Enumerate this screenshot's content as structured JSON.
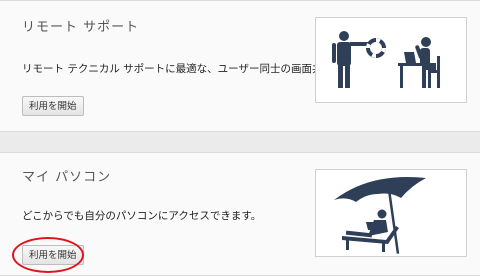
{
  "remote_support": {
    "title": "リモート サポート",
    "description": "リモート テクニカル サポートに最適な、ユーザー同士の画面共有。",
    "start_button": "利用を開始",
    "illustration_icon": "person-throwing-lifebuoy-to-person-at-computer"
  },
  "my_computers": {
    "title": "マイ パソコン",
    "description": "どこからでも自分のパソコンにアクセスできます。",
    "start_button": "利用を開始",
    "illustration_icon": "person-with-laptop-under-beach-umbrella"
  },
  "colors": {
    "pictogram": "#2f3f57",
    "highlight": "#e0141e"
  }
}
